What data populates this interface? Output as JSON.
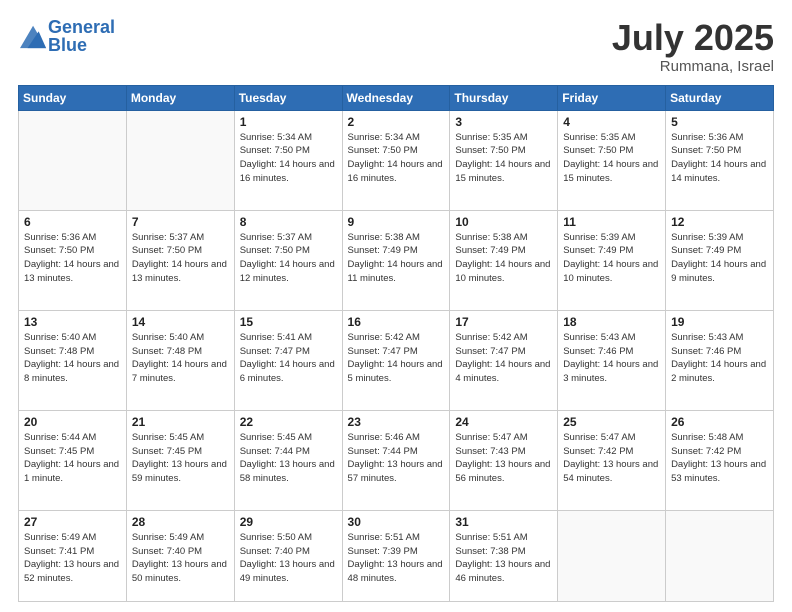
{
  "header": {
    "logo_line1": "General",
    "logo_line2": "Blue",
    "month": "July 2025",
    "location": "Rummana, Israel"
  },
  "days_of_week": [
    "Sunday",
    "Monday",
    "Tuesday",
    "Wednesday",
    "Thursday",
    "Friday",
    "Saturday"
  ],
  "weeks": [
    [
      {
        "day": "",
        "info": ""
      },
      {
        "day": "",
        "info": ""
      },
      {
        "day": "1",
        "info": "Sunrise: 5:34 AM\nSunset: 7:50 PM\nDaylight: 14 hours and 16 minutes."
      },
      {
        "day": "2",
        "info": "Sunrise: 5:34 AM\nSunset: 7:50 PM\nDaylight: 14 hours and 16 minutes."
      },
      {
        "day": "3",
        "info": "Sunrise: 5:35 AM\nSunset: 7:50 PM\nDaylight: 14 hours and 15 minutes."
      },
      {
        "day": "4",
        "info": "Sunrise: 5:35 AM\nSunset: 7:50 PM\nDaylight: 14 hours and 15 minutes."
      },
      {
        "day": "5",
        "info": "Sunrise: 5:36 AM\nSunset: 7:50 PM\nDaylight: 14 hours and 14 minutes."
      }
    ],
    [
      {
        "day": "6",
        "info": "Sunrise: 5:36 AM\nSunset: 7:50 PM\nDaylight: 14 hours and 13 minutes."
      },
      {
        "day": "7",
        "info": "Sunrise: 5:37 AM\nSunset: 7:50 PM\nDaylight: 14 hours and 13 minutes."
      },
      {
        "day": "8",
        "info": "Sunrise: 5:37 AM\nSunset: 7:50 PM\nDaylight: 14 hours and 12 minutes."
      },
      {
        "day": "9",
        "info": "Sunrise: 5:38 AM\nSunset: 7:49 PM\nDaylight: 14 hours and 11 minutes."
      },
      {
        "day": "10",
        "info": "Sunrise: 5:38 AM\nSunset: 7:49 PM\nDaylight: 14 hours and 10 minutes."
      },
      {
        "day": "11",
        "info": "Sunrise: 5:39 AM\nSunset: 7:49 PM\nDaylight: 14 hours and 10 minutes."
      },
      {
        "day": "12",
        "info": "Sunrise: 5:39 AM\nSunset: 7:49 PM\nDaylight: 14 hours and 9 minutes."
      }
    ],
    [
      {
        "day": "13",
        "info": "Sunrise: 5:40 AM\nSunset: 7:48 PM\nDaylight: 14 hours and 8 minutes."
      },
      {
        "day": "14",
        "info": "Sunrise: 5:40 AM\nSunset: 7:48 PM\nDaylight: 14 hours and 7 minutes."
      },
      {
        "day": "15",
        "info": "Sunrise: 5:41 AM\nSunset: 7:47 PM\nDaylight: 14 hours and 6 minutes."
      },
      {
        "day": "16",
        "info": "Sunrise: 5:42 AM\nSunset: 7:47 PM\nDaylight: 14 hours and 5 minutes."
      },
      {
        "day": "17",
        "info": "Sunrise: 5:42 AM\nSunset: 7:47 PM\nDaylight: 14 hours and 4 minutes."
      },
      {
        "day": "18",
        "info": "Sunrise: 5:43 AM\nSunset: 7:46 PM\nDaylight: 14 hours and 3 minutes."
      },
      {
        "day": "19",
        "info": "Sunrise: 5:43 AM\nSunset: 7:46 PM\nDaylight: 14 hours and 2 minutes."
      }
    ],
    [
      {
        "day": "20",
        "info": "Sunrise: 5:44 AM\nSunset: 7:45 PM\nDaylight: 14 hours and 1 minute."
      },
      {
        "day": "21",
        "info": "Sunrise: 5:45 AM\nSunset: 7:45 PM\nDaylight: 13 hours and 59 minutes."
      },
      {
        "day": "22",
        "info": "Sunrise: 5:45 AM\nSunset: 7:44 PM\nDaylight: 13 hours and 58 minutes."
      },
      {
        "day": "23",
        "info": "Sunrise: 5:46 AM\nSunset: 7:44 PM\nDaylight: 13 hours and 57 minutes."
      },
      {
        "day": "24",
        "info": "Sunrise: 5:47 AM\nSunset: 7:43 PM\nDaylight: 13 hours and 56 minutes."
      },
      {
        "day": "25",
        "info": "Sunrise: 5:47 AM\nSunset: 7:42 PM\nDaylight: 13 hours and 54 minutes."
      },
      {
        "day": "26",
        "info": "Sunrise: 5:48 AM\nSunset: 7:42 PM\nDaylight: 13 hours and 53 minutes."
      }
    ],
    [
      {
        "day": "27",
        "info": "Sunrise: 5:49 AM\nSunset: 7:41 PM\nDaylight: 13 hours and 52 minutes."
      },
      {
        "day": "28",
        "info": "Sunrise: 5:49 AM\nSunset: 7:40 PM\nDaylight: 13 hours and 50 minutes."
      },
      {
        "day": "29",
        "info": "Sunrise: 5:50 AM\nSunset: 7:40 PM\nDaylight: 13 hours and 49 minutes."
      },
      {
        "day": "30",
        "info": "Sunrise: 5:51 AM\nSunset: 7:39 PM\nDaylight: 13 hours and 48 minutes."
      },
      {
        "day": "31",
        "info": "Sunrise: 5:51 AM\nSunset: 7:38 PM\nDaylight: 13 hours and 46 minutes."
      },
      {
        "day": "",
        "info": ""
      },
      {
        "day": "",
        "info": ""
      }
    ]
  ]
}
